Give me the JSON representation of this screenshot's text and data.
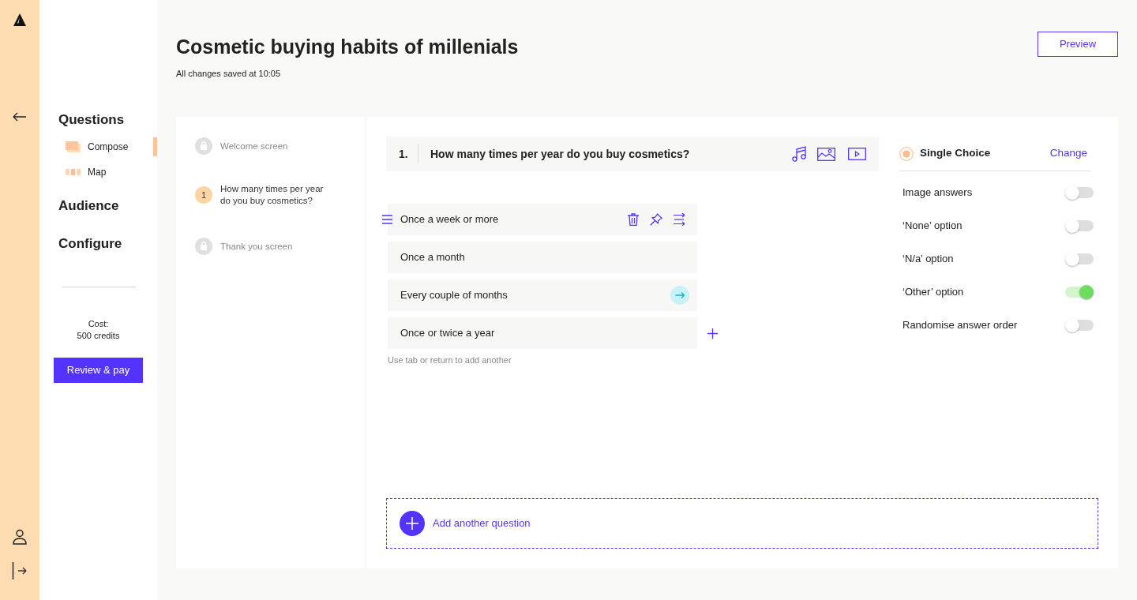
{
  "sidebar": {
    "sections": [
      {
        "label": "Questions",
        "items": [
          {
            "label": "Compose",
            "kind": "compose",
            "selected": true
          },
          {
            "label": "Map",
            "kind": "map",
            "selected": false
          }
        ]
      },
      {
        "label": "Audience"
      },
      {
        "label": "Configure"
      }
    ],
    "cost_label": "Cost:",
    "cost_value": "500 credits",
    "review_button": "Review & pay"
  },
  "header": {
    "title": "Cosmetic buying habits of millenials",
    "save_status": "All changes saved at 10:05",
    "preview_button": "Preview"
  },
  "question_list": [
    {
      "kind": "screen",
      "label": "Welcome screen"
    },
    {
      "kind": "question",
      "number": "1",
      "label": "How many times per year do you buy cosmetics?"
    },
    {
      "kind": "screen",
      "label": "Thank you screen"
    }
  ],
  "editor": {
    "question": {
      "number": "1.",
      "text": "How many times per year do you buy cosmetics?"
    },
    "answers": [
      {
        "text": "Once a week or more",
        "hovered": true,
        "logic": false
      },
      {
        "text": "Once a month",
        "hovered": false,
        "logic": false
      },
      {
        "text": "Every couple of months",
        "hovered": false,
        "logic": true
      },
      {
        "text": "Once or twice a year",
        "hovered": false,
        "logic": false
      }
    ],
    "hint": "Use tab or return to add another",
    "add_question": "Add another question"
  },
  "settings": {
    "type": "Single Choice",
    "change_link": "Change",
    "options": [
      {
        "label": "Image answers",
        "on": false
      },
      {
        "label": "‘None’ option",
        "on": false
      },
      {
        "label": "‘N/a’ option",
        "on": false
      },
      {
        "label": "‘Other’ option",
        "on": true
      },
      {
        "label": "Randomise answer order",
        "on": false
      }
    ]
  }
}
